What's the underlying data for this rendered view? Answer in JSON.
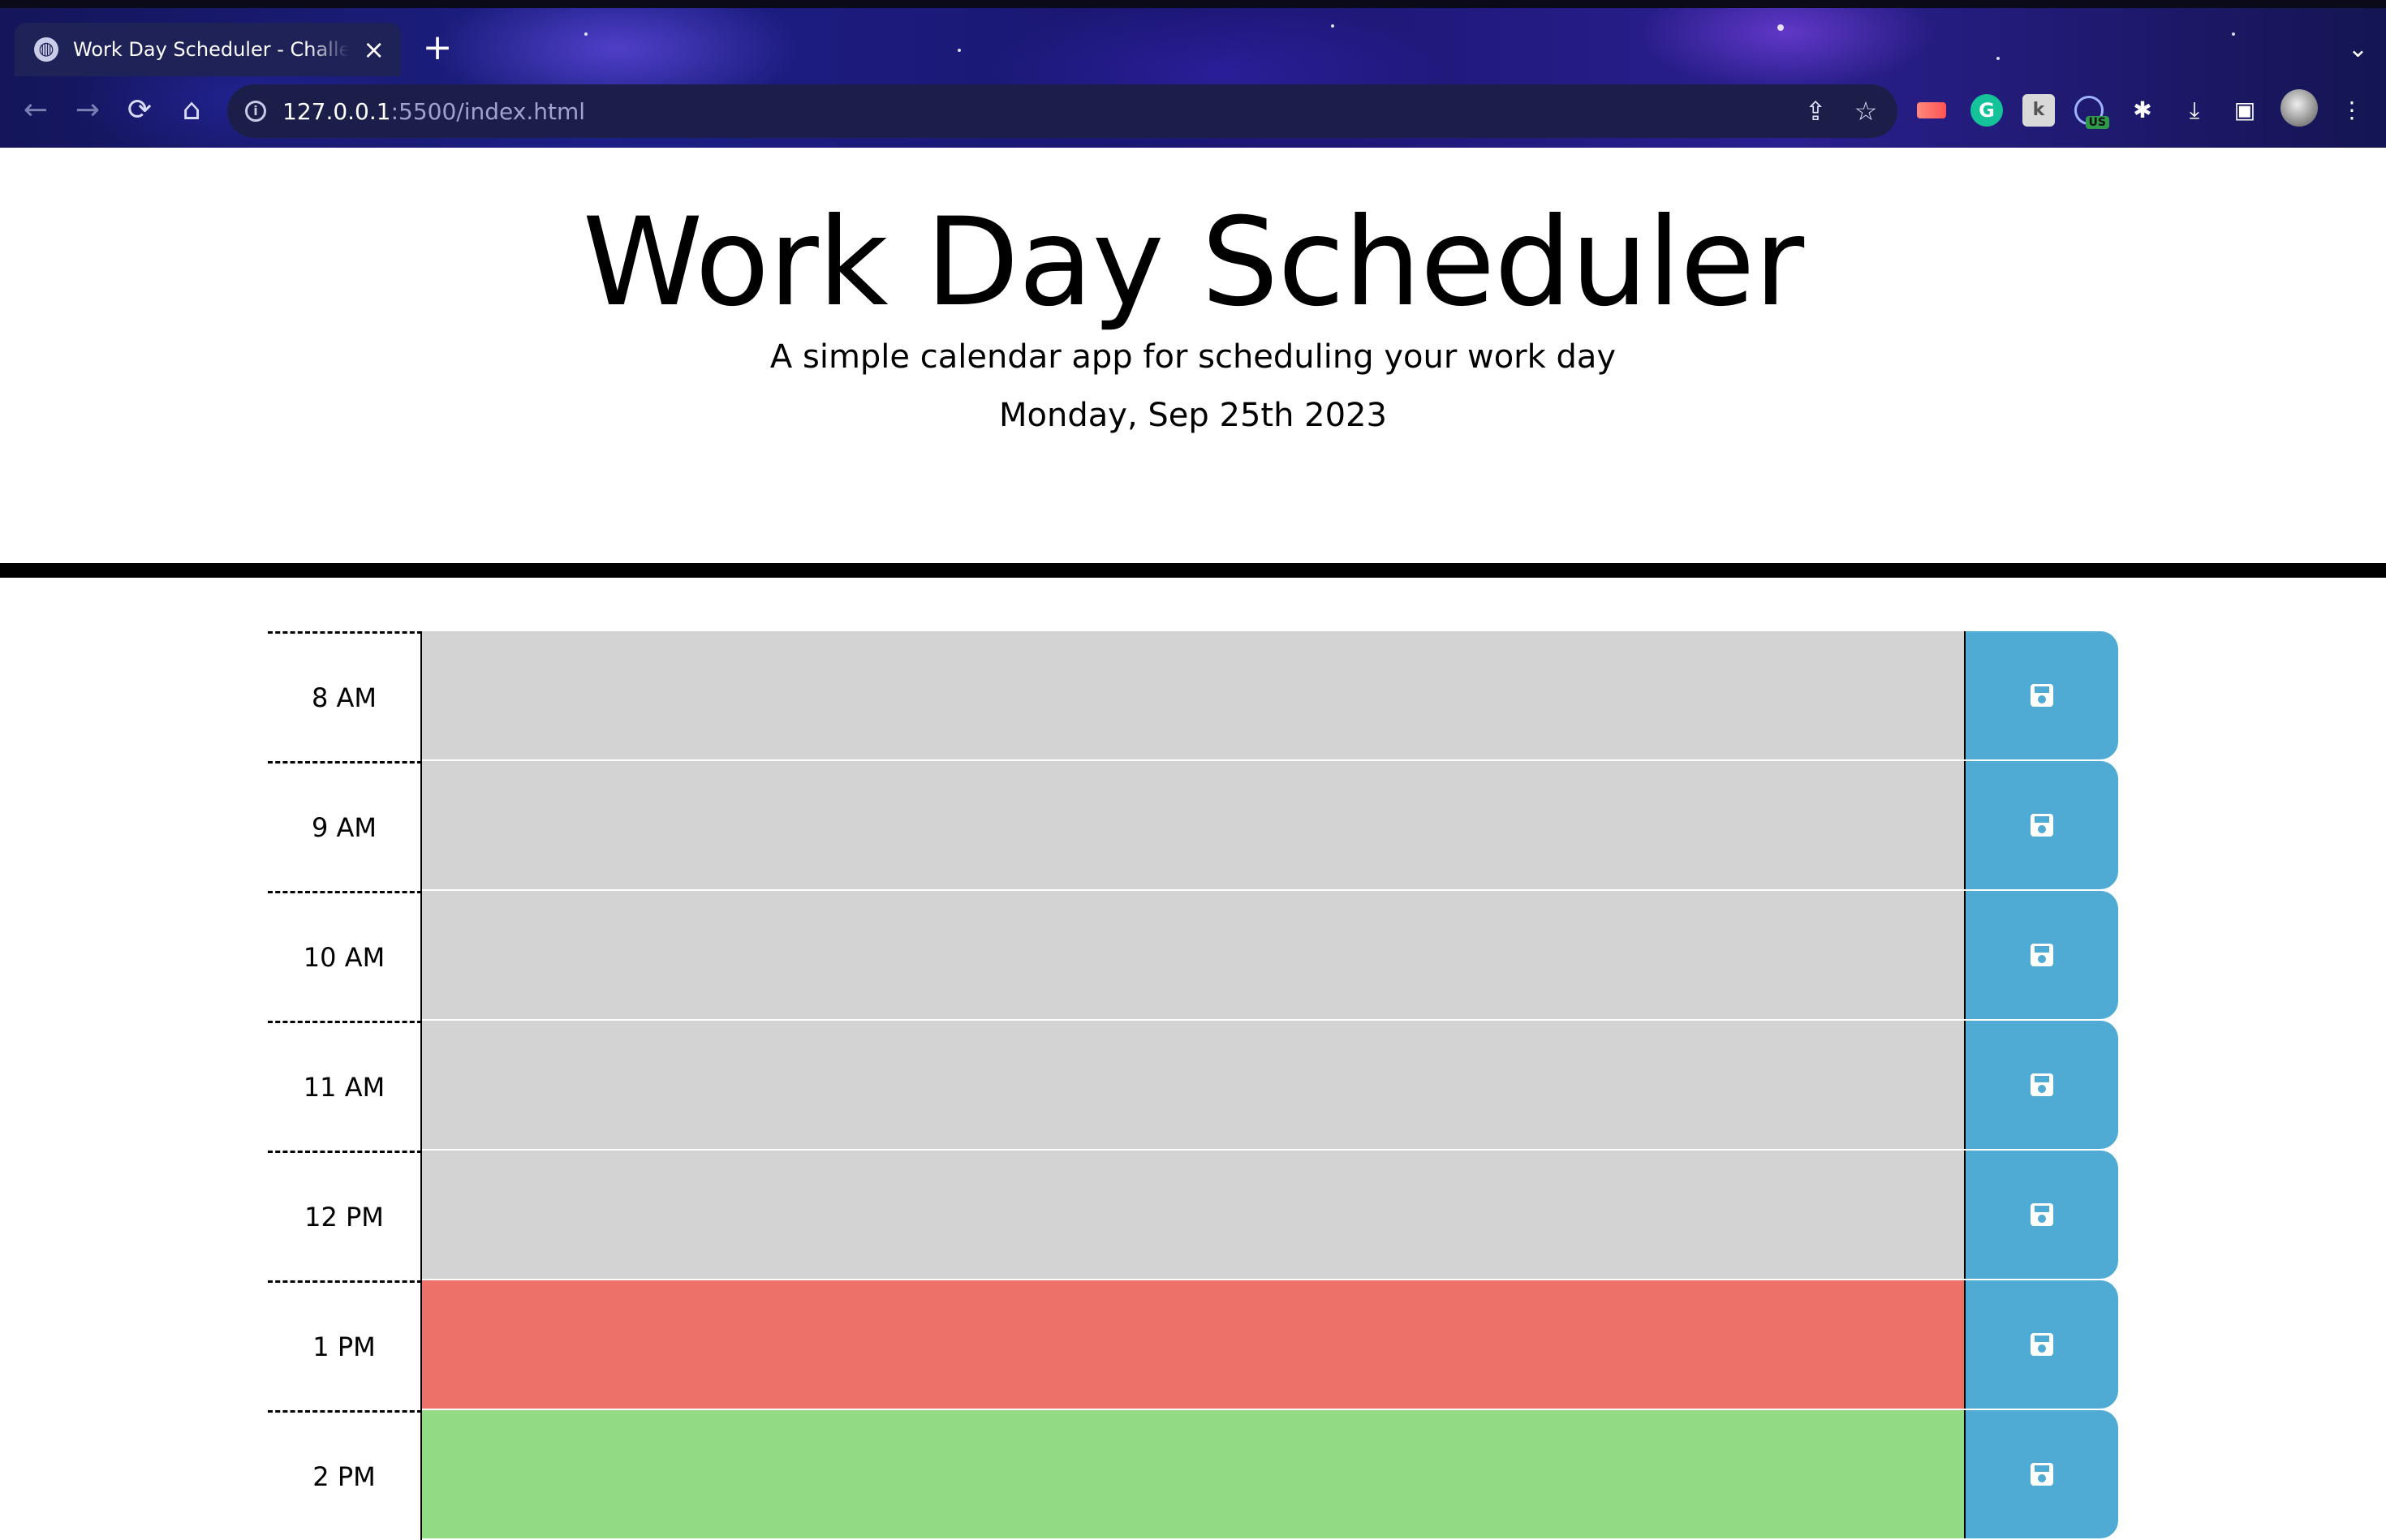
{
  "browser": {
    "tab_title": "Work Day Scheduler - Challen",
    "tab_close": "×",
    "new_tab": "+",
    "tab_menu": "⌄",
    "url_host": "127.0.0.1",
    "url_rest": ":5500/index.html",
    "nav": {
      "back": "←",
      "forward": "→",
      "reload": "⟳",
      "home": "⌂"
    },
    "actions": {
      "share": "⇪",
      "bookmark": "☆",
      "extensions": "✱",
      "download": "⤓",
      "sidepanel": "▣",
      "menu": "⋮"
    },
    "extensions_list": {
      "grammarly": "G",
      "k_ext": "k",
      "vpn_badge": "US"
    }
  },
  "header": {
    "title": "Work Day Scheduler",
    "subtitle": "A simple calendar app for scheduling your work day",
    "current_day": "Monday, Sep 25th 2023"
  },
  "time_blocks": [
    {
      "hour": "8 AM",
      "state": "past",
      "text": ""
    },
    {
      "hour": "9 AM",
      "state": "past",
      "text": ""
    },
    {
      "hour": "10 AM",
      "state": "past",
      "text": ""
    },
    {
      "hour": "11 AM",
      "state": "past",
      "text": ""
    },
    {
      "hour": "12 PM",
      "state": "past",
      "text": ""
    },
    {
      "hour": "1 PM",
      "state": "present",
      "text": ""
    },
    {
      "hour": "2 PM",
      "state": "future",
      "text": ""
    }
  ],
  "colors": {
    "past": "#d3d3d3",
    "present": "#ed7168",
    "future": "#92da83",
    "save_button": "#4fabd4"
  },
  "icons": {
    "save": "save-icon (floppy disk)"
  }
}
